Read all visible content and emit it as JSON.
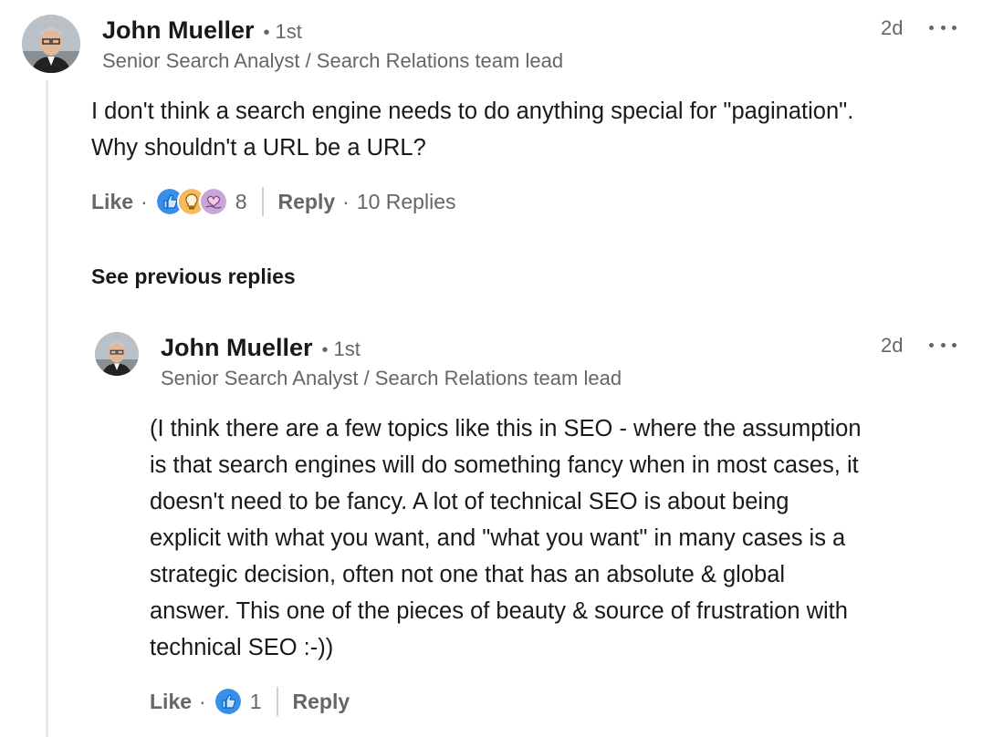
{
  "comment": {
    "author": "John Mueller",
    "degree": "1st",
    "headline": "Senior Search Analyst / Search Relations team lead",
    "time": "2d",
    "text_lines": [
      "I don't think a search engine needs to do anything special for \"pagination\".",
      "Why shouldn't a URL be a URL?"
    ],
    "like_label": "Like",
    "reactions": [
      "like-icon",
      "insightful-icon",
      "support-icon"
    ],
    "reaction_count": "8",
    "reply_label": "Reply",
    "replies_count": "10 Replies"
  },
  "see_previous_replies": "See previous replies",
  "reply": {
    "author": "John Mueller",
    "degree": "1st",
    "headline": "Senior Search Analyst / Search Relations team lead",
    "time": "2d",
    "text_lines": [
      "(I think there are a few topics like this in SEO - where the assumption",
      "is that search engines will do something fancy when in most cases, it",
      "doesn't need to be fancy. A lot of technical SEO is about being",
      "explicit with what you want, and \"what you want\" in many cases is a",
      "strategic decision, often not one that has an absolute & global",
      "answer. This one of the pieces of beauty & source of frustration with",
      "technical SEO :-))"
    ],
    "like_label": "Like",
    "reactions": [
      "like-icon"
    ],
    "reaction_count": "1",
    "reply_label": "Reply"
  },
  "colors": {
    "like_blue": "#378fe9",
    "insightful_yellow": "#f5bb5c",
    "support_purple": "#c9a6d8",
    "secondary_text": "#666666",
    "thread_line": "#e9e9e9"
  }
}
